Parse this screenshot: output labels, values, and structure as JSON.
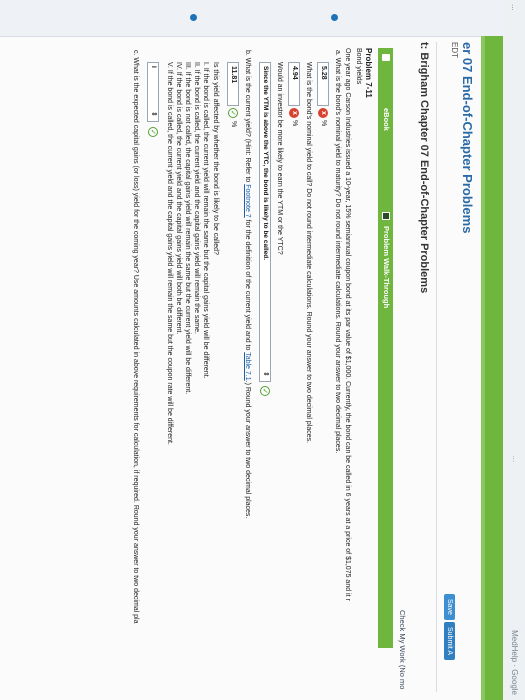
{
  "header": {
    "breadcrumb": "...",
    "mh_title": "...",
    "mh_link": "MedHelp · Google"
  },
  "assignment": {
    "title": "er 07 End-of-Chapter Problems",
    "subtitle": "EDT",
    "chapter_title": "t: Brigham Chapter 07 End-of-Chapter Problems",
    "save_label": "Save",
    "submit_label": "Submit A",
    "check_my_work": "Check My Work (No mo"
  },
  "tabs": {
    "ebook": "eBook",
    "walkthrough": "Problem Walk-Through"
  },
  "problem": {
    "number": "Problem 7-11",
    "name": "Bond yields",
    "statement": "One year ago Carson Industries issued a 10-year, 15% semiannual coupon bond at its par value of $1,000. Currently, the bond can be called in 6 years at a price of $1,075 and it r",
    "part_a_q1": "a.  What is the bond's nominal yield to maturity? Do not round intermediate calculations. Round your answer to two decimal places.",
    "part_a_ans1": "5.28",
    "part_a_q2": "What is the bond's nominal yield to call? Do not round intermediate calculations. Round your answer to two decimal places.",
    "part_a_ans2": "4.94",
    "part_a_q3": "Would an investor be more likely to earn the YTM or the YTC?",
    "part_a_ans3": "Since the YTM is above the YTC, the bond is likely to be called.",
    "part_b_q1_pre": "b.  What is the current yield? (Hint: Refer to ",
    "part_b_q1_link1": "Footnote 7",
    "part_b_q1_mid": " for the definition of the current yield and to ",
    "part_b_q1_link2": "Table 7.1",
    "part_b_q1_post": ".) Round your answer to two decimal places.",
    "part_b_ans1": "11.81",
    "part_b_q2": "Is this yield affected by whether the bond is likely to be called?",
    "options": [
      "I.   If the bond is called, the current yield will remain the same but the capital gains yield will be different.",
      "II.  If the bond is called, the current yield and the capital gains yield will remain the same.",
      "III. If the bond is not called, the capital gains yield will remain the same but the current yield will be different.",
      "IV.  If the bond is called, the current yield and the capital gains yield will both be different.",
      "V.   If the bond is called, the current yield and the capital gains yield will remain the same but the coupon rate will be different."
    ],
    "part_b_ans2": "I",
    "part_c_q": "c.  What is the expected capital gains (or loss) yield for the coming year? Use amounts calculated in above requirements for calculation, if required. Round your answer to two decimal pla",
    "pct_sign": "%",
    "wrong_mark": "x",
    "correct_mark": "✓",
    "dropdown_arrow": "⇕"
  },
  "colors": {
    "green_bar": "#6fb63f",
    "link_blue": "#1d5fa8",
    "wrong_red": "#d9412f",
    "correct_green": "#53a133"
  }
}
